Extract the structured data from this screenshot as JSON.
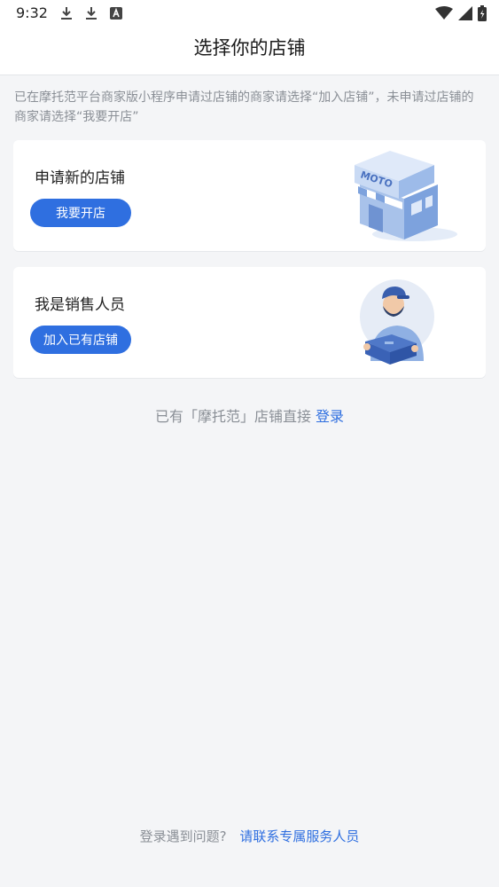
{
  "status_bar": {
    "time": "9:32",
    "icons_left": [
      "download-icon",
      "download-icon",
      "keyboard-a-icon"
    ],
    "icons_right": [
      "wifi-icon",
      "signal-icon",
      "battery-charging-icon"
    ]
  },
  "header": {
    "title": "选择你的店铺"
  },
  "info": {
    "text": "已在摩托范平台商家版小程序申请过店铺的商家请选择“加入店铺”，未申请过店铺的商家请选择“我要开店”"
  },
  "cards": {
    "new_shop": {
      "title": "申请新的店铺",
      "button": "我要开店",
      "illustration_label": "MOTO"
    },
    "sales": {
      "title": "我是销售人员",
      "button": "加入已有店铺"
    }
  },
  "login": {
    "prefix": "已有「摩托范」店铺直接",
    "link": "登录"
  },
  "help": {
    "prefix": "登录遇到问题?",
    "link": "请联系专属服务人员"
  },
  "colors": {
    "accent": "#2f6fe0",
    "background": "#f4f5f7",
    "muted_text": "#8a8f96"
  }
}
